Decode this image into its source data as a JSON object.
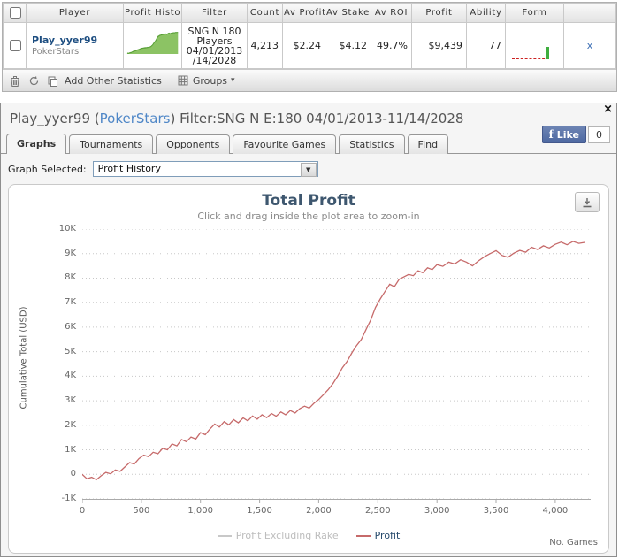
{
  "table": {
    "headers": [
      "",
      "Player",
      "Profit Histor",
      "Filter",
      "Count",
      "Av Profit",
      "Av Stake",
      "Av ROI",
      "Profit",
      "Ability",
      "Form",
      ""
    ],
    "row": {
      "player": "Play_yyer99",
      "site": "PokerStars",
      "filter_lines": [
        "SNG N 180",
        "Players",
        "04/01/2013",
        "/14/2028"
      ],
      "count": "4,213",
      "av_profit": "$2.24",
      "av_stake": "$4.12",
      "av_roi": "49.7%",
      "profit": "$9,439",
      "ability": "77",
      "remove_label": "x"
    },
    "toolbar": {
      "add_other_statistics": "Add Other Statistics",
      "groups_label": "Groups",
      "groups_caret": "▾"
    }
  },
  "panel": {
    "close_label": "×",
    "title_player": "Play_yyer99",
    "title_sep": " (",
    "title_site": "PokerStars",
    "title_rest": ") Filter:SNG N E:180 04/01/2013-11/14/2028",
    "like": {
      "f": "f",
      "label": "Like",
      "count": "0"
    },
    "tabs": [
      {
        "label": "Graphs"
      },
      {
        "label": "Tournaments"
      },
      {
        "label": "Opponents"
      },
      {
        "label": "Favourite Games"
      },
      {
        "label": "Statistics"
      },
      {
        "label": "Find"
      }
    ],
    "graph_selected": {
      "label": "Graph Selected:",
      "value": "Profit History",
      "arrow": "▼"
    }
  },
  "chart_data": {
    "type": "line",
    "title": "Total Profit",
    "subtitle": "Click and drag inside the plot area to zoom-in",
    "ylabel": "Cumulative Total (USD)",
    "xlabel": "No. Games",
    "xlim": [
      0,
      4300
    ],
    "ylim": [
      -1000,
      10000
    ],
    "grid": "dotted-horizontal",
    "yticks": [
      {
        "value": -1000,
        "label": "-1K"
      },
      {
        "value": 0,
        "label": "0"
      },
      {
        "value": 1000,
        "label": "1K"
      },
      {
        "value": 2000,
        "label": "2K"
      },
      {
        "value": 3000,
        "label": "3K"
      },
      {
        "value": 4000,
        "label": "4K"
      },
      {
        "value": 5000,
        "label": "5K"
      },
      {
        "value": 6000,
        "label": "6K"
      },
      {
        "value": 7000,
        "label": "7K"
      },
      {
        "value": 8000,
        "label": "8K"
      },
      {
        "value": 9000,
        "label": "9K"
      },
      {
        "value": 10000,
        "label": "10K"
      }
    ],
    "xticks": [
      {
        "value": 0,
        "label": "0"
      },
      {
        "value": 500,
        "label": "500"
      },
      {
        "value": 1000,
        "label": "1,000"
      },
      {
        "value": 1500,
        "label": "1,500"
      },
      {
        "value": 2000,
        "label": "2,000"
      },
      {
        "value": 2500,
        "label": "2,500"
      },
      {
        "value": 3000,
        "label": "3,000"
      },
      {
        "value": 3500,
        "label": "3,500"
      },
      {
        "value": 4000,
        "label": "4,000"
      }
    ],
    "legend": [
      {
        "name": "Profit Excluding Rake",
        "color": "#c8c8c8",
        "text_color": "#bdbdbd",
        "disabled": true
      },
      {
        "name": "Profit",
        "color": "#c66a6a",
        "text_color": "#274b6d",
        "disabled": false
      }
    ],
    "series": [
      {
        "name": "Profit",
        "color": "#c66a6a",
        "points": [
          [
            0,
            0
          ],
          [
            40,
            -180
          ],
          [
            80,
            -120
          ],
          [
            120,
            -220
          ],
          [
            160,
            -60
          ],
          [
            200,
            80
          ],
          [
            240,
            20
          ],
          [
            280,
            180
          ],
          [
            320,
            120
          ],
          [
            360,
            300
          ],
          [
            400,
            480
          ],
          [
            440,
            420
          ],
          [
            480,
            640
          ],
          [
            520,
            780
          ],
          [
            560,
            720
          ],
          [
            600,
            900
          ],
          [
            640,
            840
          ],
          [
            680,
            1060
          ],
          [
            720,
            1000
          ],
          [
            760,
            1240
          ],
          [
            800,
            1160
          ],
          [
            840,
            1420
          ],
          [
            880,
            1330
          ],
          [
            920,
            1520
          ],
          [
            960,
            1440
          ],
          [
            1000,
            1700
          ],
          [
            1040,
            1620
          ],
          [
            1080,
            1850
          ],
          [
            1120,
            2050
          ],
          [
            1160,
            1930
          ],
          [
            1200,
            2150
          ],
          [
            1240,
            2020
          ],
          [
            1280,
            2230
          ],
          [
            1320,
            2100
          ],
          [
            1360,
            2300
          ],
          [
            1400,
            2180
          ],
          [
            1440,
            2380
          ],
          [
            1480,
            2250
          ],
          [
            1520,
            2430
          ],
          [
            1560,
            2310
          ],
          [
            1600,
            2480
          ],
          [
            1640,
            2370
          ],
          [
            1680,
            2540
          ],
          [
            1720,
            2430
          ],
          [
            1760,
            2600
          ],
          [
            1800,
            2500
          ],
          [
            1840,
            2680
          ],
          [
            1880,
            2780
          ],
          [
            1920,
            2700
          ],
          [
            1960,
            2900
          ],
          [
            2000,
            3050
          ],
          [
            2040,
            3250
          ],
          [
            2080,
            3450
          ],
          [
            2120,
            3700
          ],
          [
            2160,
            4000
          ],
          [
            2200,
            4350
          ],
          [
            2240,
            4600
          ],
          [
            2280,
            4950
          ],
          [
            2320,
            5250
          ],
          [
            2360,
            5500
          ],
          [
            2400,
            5900
          ],
          [
            2440,
            6300
          ],
          [
            2480,
            6800
          ],
          [
            2520,
            7150
          ],
          [
            2560,
            7450
          ],
          [
            2600,
            7750
          ],
          [
            2640,
            7650
          ],
          [
            2680,
            7950
          ],
          [
            2720,
            8050
          ],
          [
            2760,
            8150
          ],
          [
            2800,
            8100
          ],
          [
            2840,
            8300
          ],
          [
            2880,
            8220
          ],
          [
            2920,
            8420
          ],
          [
            2960,
            8350
          ],
          [
            3000,
            8550
          ],
          [
            3050,
            8480
          ],
          [
            3100,
            8650
          ],
          [
            3150,
            8580
          ],
          [
            3200,
            8750
          ],
          [
            3250,
            8650
          ],
          [
            3300,
            8500
          ],
          [
            3350,
            8700
          ],
          [
            3400,
            8870
          ],
          [
            3450,
            9000
          ],
          [
            3500,
            9120
          ],
          [
            3550,
            8930
          ],
          [
            3600,
            8850
          ],
          [
            3650,
            9020
          ],
          [
            3700,
            9130
          ],
          [
            3750,
            9060
          ],
          [
            3800,
            9260
          ],
          [
            3850,
            9170
          ],
          [
            3900,
            9320
          ],
          [
            3950,
            9230
          ],
          [
            4000,
            9380
          ],
          [
            4050,
            9470
          ],
          [
            4100,
            9360
          ],
          [
            4150,
            9500
          ],
          [
            4200,
            9420
          ],
          [
            4250,
            9460
          ]
        ]
      }
    ],
    "sparkline": {
      "fill": "#8cc364",
      "stroke": "#579f35"
    }
  }
}
